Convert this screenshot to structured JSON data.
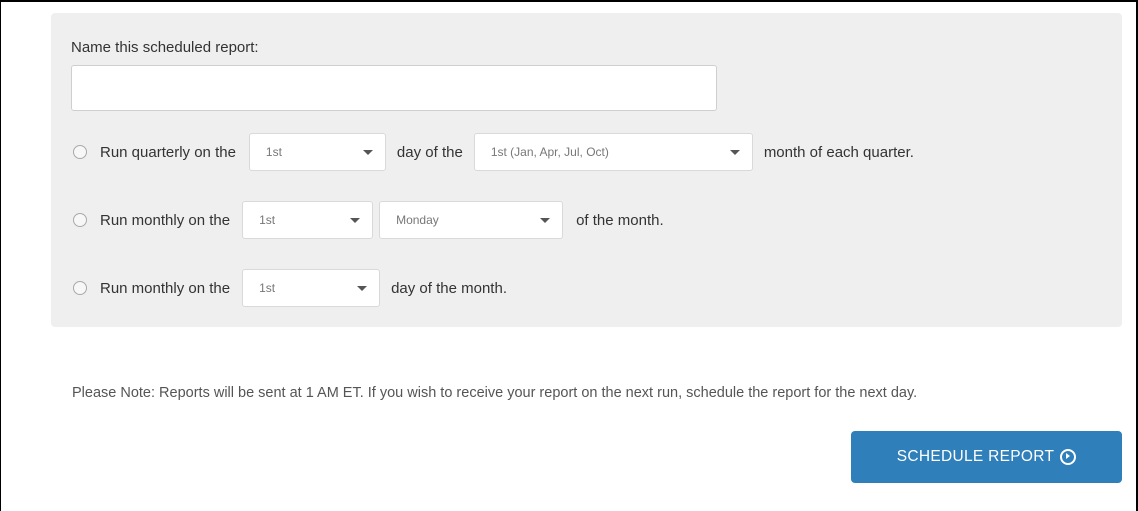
{
  "form": {
    "name_label": "Name this scheduled report:",
    "name_value": "",
    "name_placeholder": ""
  },
  "options": {
    "quarterly": {
      "prefix": "Run quarterly on the",
      "day_value": "1st",
      "middle": "day of the",
      "month_value": "1st (Jan, Apr, Jul, Oct)",
      "suffix": "month of each quarter."
    },
    "monthly_weekday": {
      "prefix": "Run monthly on the",
      "ordinal_value": "1st",
      "weekday_value": "Monday",
      "suffix": "of the month."
    },
    "monthly_day": {
      "prefix": "Run monthly on the",
      "day_value": "1st",
      "suffix": "day of the month."
    }
  },
  "note": "Please Note: Reports will be sent at 1 AM ET. If you wish to receive your report on the next run, schedule the report for the next day.",
  "submit": {
    "label": "SCHEDULE REPORT",
    "icon": "circle-play-icon"
  },
  "colors": {
    "panel": "#efefef",
    "button": "#2f7fbb"
  }
}
